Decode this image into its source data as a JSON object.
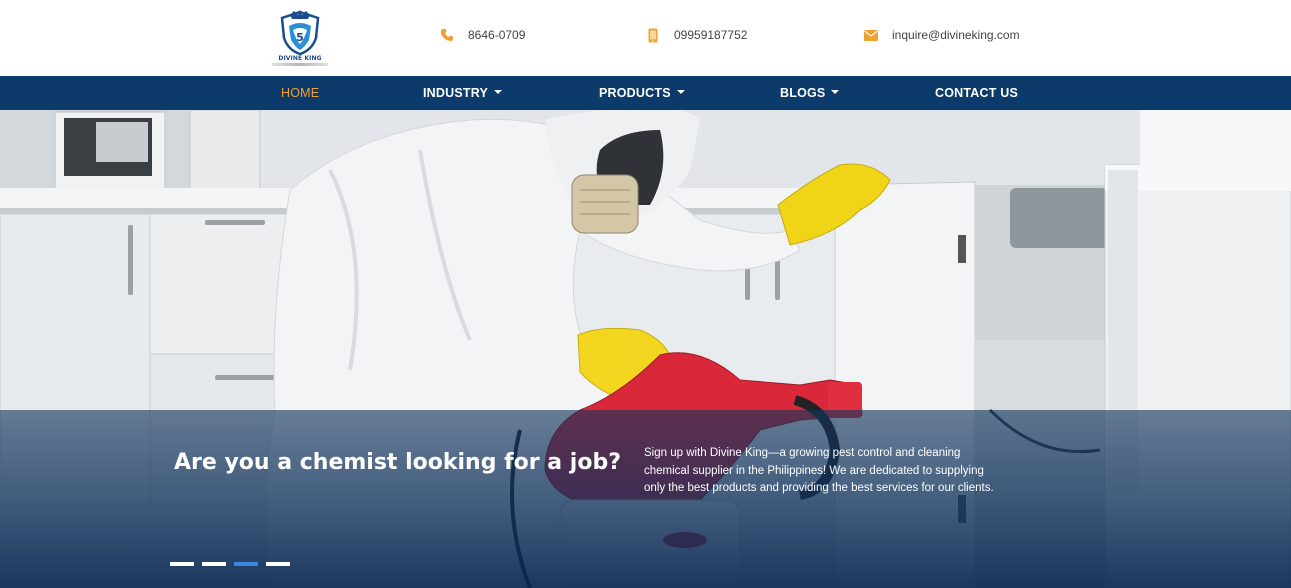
{
  "brand": {
    "name": "DIVINE KING"
  },
  "contact": {
    "phone": "8646-0709",
    "mobile": "09959187752",
    "email": "inquire@divineking.com"
  },
  "nav": {
    "items": [
      {
        "label": "HOME",
        "active": true,
        "dropdown": false
      },
      {
        "label": "INDUSTRY",
        "active": false,
        "dropdown": true
      },
      {
        "label": "PRODUCTS",
        "active": false,
        "dropdown": true
      },
      {
        "label": "BLOGS",
        "active": false,
        "dropdown": true
      },
      {
        "label": "CONTACT US",
        "active": false,
        "dropdown": false
      }
    ]
  },
  "hero": {
    "title": "Are you a chemist looking for a job?",
    "text": "Sign up with Divine King—a growing pest control and cleaning chemical supplier in the Philippines! We are dedicated to supplying only the best products and providing the best services for our clients.",
    "slides": {
      "count": 4,
      "active_index": 2
    }
  },
  "colors": {
    "nav_bg": "#0c3a6b",
    "nav_active": "#f0a030",
    "icon_accent": "#f0a030",
    "slide_active": "#3a86e0"
  },
  "icons": [
    "phone-icon",
    "mobile-phone-icon",
    "mail-icon",
    "chevron-down-icon"
  ]
}
